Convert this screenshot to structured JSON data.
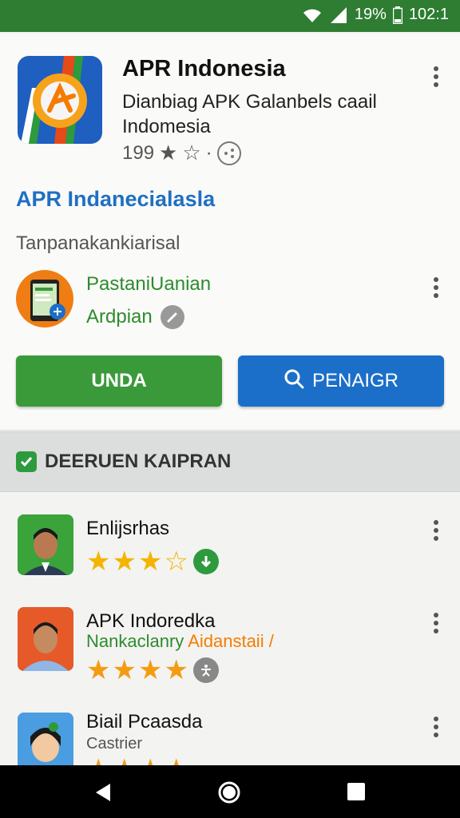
{
  "status": {
    "battery": "19%",
    "time": "102:1"
  },
  "app": {
    "title": "APR Indonesia",
    "subtitle": "Dianbiag APK Galanbels caail Indomesia",
    "rating": "199"
  },
  "developer_link": "APR Indanecialasla",
  "category": "Tanpanakankiarisal",
  "promo": {
    "line1": "PastaniUanian",
    "line2": "Ardpian"
  },
  "buttons": {
    "install": "UNDA",
    "search": "PENAIGR"
  },
  "section": {
    "title": "DEERUEN KAIPRAN"
  },
  "list": [
    {
      "title": "Enlijsrhas",
      "subtitle": "",
      "stars": 3
    },
    {
      "title": "APK Indoredka",
      "subtitle_a": "Nankaclanry",
      "subtitle_b": "Aidanstaii /",
      "stars": 4
    },
    {
      "title": "Biail Pcaasda",
      "subtitle": "Castrier",
      "stars": 4
    }
  ],
  "colors": {
    "status_bar": "#2e7d32",
    "primary_green": "#3a9a3a",
    "primary_blue": "#1b6fc8",
    "link_blue": "#1f6fc4",
    "star": "#f4b400"
  },
  "icons": [
    "wifi-icon",
    "signal-icon",
    "battery-icon",
    "star-icon",
    "more-vert-icon",
    "edit-icon",
    "search-icon",
    "download-icon",
    "back-icon",
    "home-icon",
    "recents-icon"
  ]
}
